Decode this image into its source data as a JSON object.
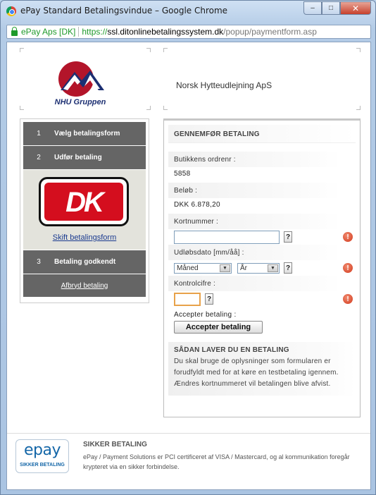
{
  "window": {
    "title": "ePay Standard Betalingsvindue – Google Chrome",
    "controls": {
      "minimize": "–",
      "maximize": "□",
      "close": "✕"
    }
  },
  "address_bar": {
    "site_identity": "ePay Aps [DK]",
    "scheme": "https://",
    "host": "ssl.ditonlinebetalingssystem.dk",
    "path": "/popup/paymentform.asp"
  },
  "header": {
    "logo_text": "NHU Gruppen",
    "shop_name": "Norsk Hytteudlejning ApS"
  },
  "steps": [
    {
      "num": "1",
      "label": "Vælg betalingsform"
    },
    {
      "num": "2",
      "label": "Udfør betaling"
    },
    {
      "num": "3",
      "label": "Betaling godkendt"
    }
  ],
  "card": {
    "logo_text": "DK",
    "change_link": "Skift betalingsform",
    "cancel_link": "Afbryd betaling"
  },
  "form": {
    "heading": "GENNEMFØR BETALING",
    "order_label": "Butikkens ordrenr :",
    "order_value": "5858",
    "amount_label": "Beløb :",
    "amount_value": "DKK 6.878,20",
    "card_number_label": "Kortnummer :",
    "card_number_value": "",
    "expiry_label": "Udløbsdato [mm/åå] :",
    "month_select": "Måned",
    "year_select": "År",
    "cvc_label": "Kontrolcifre :",
    "cvc_value": "",
    "accept_label": "Accepter betaling :",
    "accept_button": "Accepter betaling",
    "help_glyph": "?",
    "warning_glyph": "!",
    "select_arrow": "▼"
  },
  "howto": {
    "title": "SÅDAN LAVER DU EN BETALING",
    "text": "Du skal bruge de oplysninger som formularen er forudfyldt med for at køre en testbetaling igennem. Ændres kortnummeret vil betalingen blive afvist."
  },
  "footer": {
    "logo_word": "epay",
    "logo_sub": "SIKKER BETALING",
    "title": "SIKKER BETALING",
    "text": "ePay / Payment Solutions er PCI certificeret af VISA / Mastercard, og al kommunikation foregår krypteret via en sikker forbindelse."
  },
  "colors": {
    "step_bg": "#656565",
    "dk_red": "#d40e1e",
    "link": "#1a3a8f",
    "secure_green": "#1e9a2a",
    "epay_blue": "#1567a8",
    "warning": "#d2391c"
  }
}
